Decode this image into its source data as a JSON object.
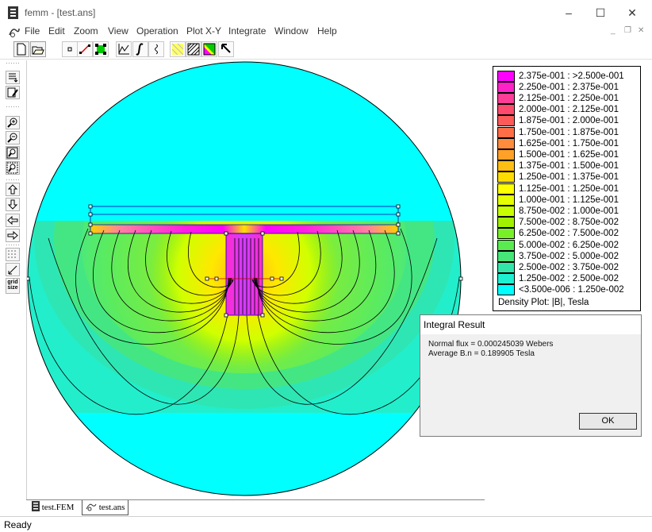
{
  "window": {
    "title": "femm - [test.ans]",
    "controls": {
      "minimize": "–",
      "maximize": "☐",
      "close": "✕"
    }
  },
  "menu": [
    "File",
    "Edit",
    "Zoom",
    "View",
    "Operation",
    "Plot X-Y",
    "Integrate",
    "Window",
    "Help"
  ],
  "mdi_controls": {
    "minimize": "_",
    "restore": "❐",
    "close": "✕"
  },
  "toolbar": {
    "icons": [
      "new-file-icon",
      "open-file-icon",
      "point-mode-icon",
      "contour-mode-icon",
      "area-mode-icon",
      "plot-xy-icon",
      "integrate-icon",
      "snap-icon",
      "show-mesh-icon",
      "density-plot-icon",
      "contour-plot-icon",
      "pointer-icon"
    ]
  },
  "left_toolbar": {
    "icons": [
      "show-points-icon",
      "show-labels-icon",
      "zoom-in-icon",
      "zoom-out-icon",
      "zoom-window-icon",
      "zoom-natural-icon",
      "pan-up-icon",
      "pan-down-icon",
      "pan-left-icon",
      "pan-right-icon",
      "show-grid-icon",
      "snap-grid-icon",
      "grid-size-icon"
    ],
    "grid_size_label": "grid size"
  },
  "legend": {
    "rows": [
      {
        "label": "2.375e-001 : >2.500e-001",
        "color": "#ff00ff"
      },
      {
        "label": "2.250e-001 : 2.375e-001",
        "color": "#ff22c8"
      },
      {
        "label": "2.125e-001 : 2.250e-001",
        "color": "#ff3c96"
      },
      {
        "label": "2.000e-001 : 2.125e-001",
        "color": "#ff4a6e"
      },
      {
        "label": "1.875e-001 : 2.000e-001",
        "color": "#ff5a5a"
      },
      {
        "label": "1.750e-001 : 1.875e-001",
        "color": "#ff6e46"
      },
      {
        "label": "1.625e-001 : 1.750e-001",
        "color": "#ff8c3c"
      },
      {
        "label": "1.500e-001 : 1.625e-001",
        "color": "#ffa028"
      },
      {
        "label": "1.375e-001 : 1.500e-001",
        "color": "#ffbe14"
      },
      {
        "label": "1.250e-001 : 1.375e-001",
        "color": "#ffdc00"
      },
      {
        "label": "1.125e-001 : 1.250e-001",
        "color": "#ffff00"
      },
      {
        "label": "1.000e-001 : 1.125e-001",
        "color": "#e6ff00"
      },
      {
        "label": "8.750e-002 : 1.000e-001",
        "color": "#c8ff00"
      },
      {
        "label": "7.500e-002 : 8.750e-002",
        "color": "#a0f000"
      },
      {
        "label": "6.250e-002 : 7.500e-002",
        "color": "#78f028"
      },
      {
        "label": "5.000e-002 : 6.250e-002",
        "color": "#5aeb50"
      },
      {
        "label": "3.750e-002 : 5.000e-002",
        "color": "#46e678"
      },
      {
        "label": "2.500e-002 : 3.750e-002",
        "color": "#32e6aa"
      },
      {
        "label": "1.250e-002 : 2.500e-002",
        "color": "#1ef0d2"
      },
      {
        "label": "<3.500e-006 : 1.250e-002",
        "color": "#00ffff"
      }
    ],
    "footer": "Density Plot: |B|, Tesla"
  },
  "dialog": {
    "title": "Integral Result",
    "line1": "Normal flux = 0.000245039 Webers",
    "line2": "Average B.n = 0.189905 Tesla",
    "ok_label": "OK"
  },
  "tabs": [
    {
      "label": "test.FEM",
      "icon": "femm-doc-icon"
    },
    {
      "label": "test.ans",
      "icon": "femm-result-icon"
    }
  ],
  "status": "Ready"
}
